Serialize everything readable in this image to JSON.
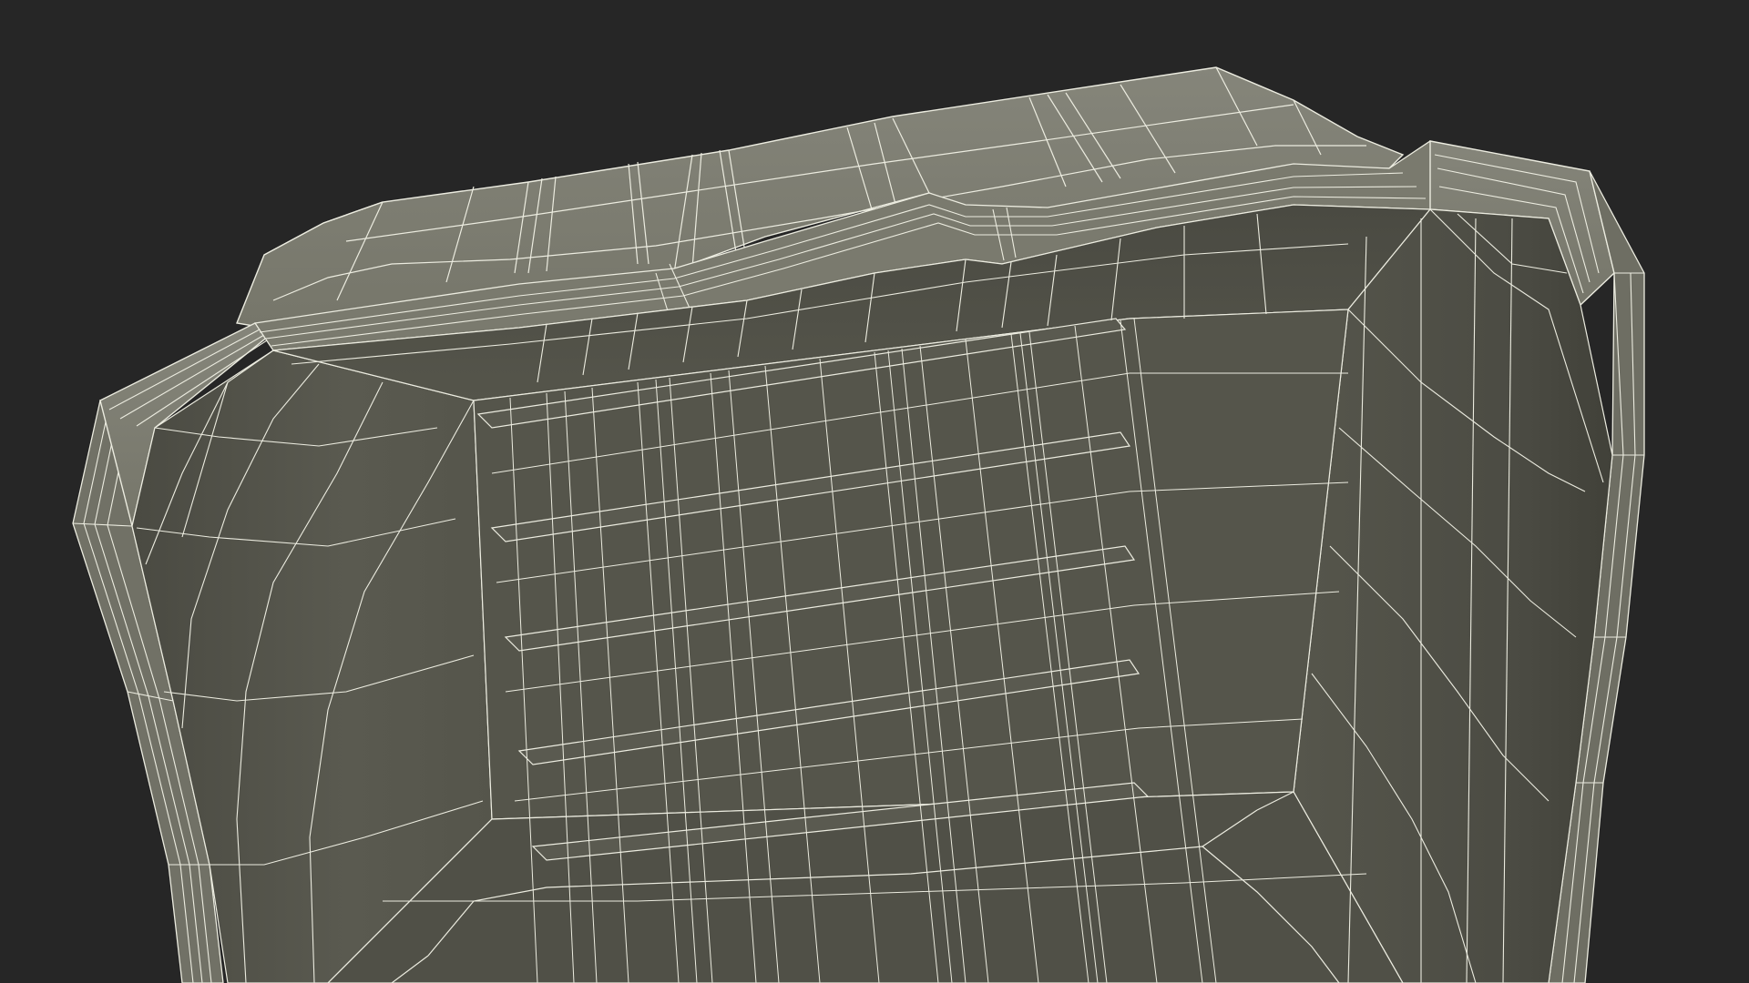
{
  "scene": {
    "subject": "wireframe-tray-model",
    "background_color": "#262626",
    "rim_top_color": "#7e7e72",
    "rim_side_color": "#6c6c60",
    "inner_wall_color": "#4f4f46",
    "inner_wall_light_color": "#5b5b51",
    "floor_color": "#55554b",
    "wire_color": "#ecece0"
  }
}
